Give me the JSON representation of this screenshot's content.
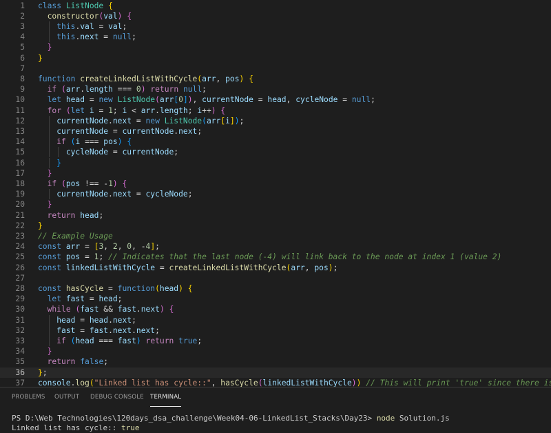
{
  "editor": {
    "active_line": 36,
    "lines": [
      [
        [
          "kw",
          "class"
        ],
        [
          "p",
          " "
        ],
        [
          "cls",
          "ListNode"
        ],
        [
          "p",
          " "
        ],
        [
          "b1",
          "{"
        ]
      ],
      [
        [
          "p",
          "  "
        ],
        [
          "fn",
          "constructor"
        ],
        [
          "b2",
          "("
        ],
        [
          "var",
          "val"
        ],
        [
          "b2",
          ")"
        ],
        [
          "p",
          " "
        ],
        [
          "b2",
          "{"
        ]
      ],
      [
        [
          "p",
          "    "
        ],
        [
          "kw",
          "this"
        ],
        [
          "p",
          "."
        ],
        [
          "var",
          "val"
        ],
        [
          "p",
          " = "
        ],
        [
          "var",
          "val"
        ],
        [
          "p",
          ";"
        ]
      ],
      [
        [
          "p",
          "    "
        ],
        [
          "kw",
          "this"
        ],
        [
          "p",
          "."
        ],
        [
          "var",
          "next"
        ],
        [
          "p",
          " = "
        ],
        [
          "kw",
          "null"
        ],
        [
          "p",
          ";"
        ]
      ],
      [
        [
          "p",
          "  "
        ],
        [
          "b2",
          "}"
        ]
      ],
      [
        [
          "b1",
          "}"
        ]
      ],
      [],
      [
        [
          "kw",
          "function"
        ],
        [
          "p",
          " "
        ],
        [
          "fn",
          "createLinkedListWithCycle"
        ],
        [
          "b1",
          "("
        ],
        [
          "var",
          "arr"
        ],
        [
          "p",
          ", "
        ],
        [
          "var",
          "pos"
        ],
        [
          "b1",
          ")"
        ],
        [
          "p",
          " "
        ],
        [
          "b1",
          "{"
        ]
      ],
      [
        [
          "p",
          "  "
        ],
        [
          "ctl",
          "if"
        ],
        [
          "p",
          " "
        ],
        [
          "b2",
          "("
        ],
        [
          "var",
          "arr"
        ],
        [
          "p",
          "."
        ],
        [
          "var",
          "length"
        ],
        [
          "p",
          " === "
        ],
        [
          "num",
          "0"
        ],
        [
          "b2",
          ")"
        ],
        [
          "p",
          " "
        ],
        [
          "ctl",
          "return"
        ],
        [
          "p",
          " "
        ],
        [
          "kw",
          "null"
        ],
        [
          "p",
          ";"
        ]
      ],
      [
        [
          "p",
          "  "
        ],
        [
          "kw",
          "let"
        ],
        [
          "p",
          " "
        ],
        [
          "var",
          "head"
        ],
        [
          "p",
          " = "
        ],
        [
          "kw",
          "new"
        ],
        [
          "p",
          " "
        ],
        [
          "cls",
          "ListNode"
        ],
        [
          "b2",
          "("
        ],
        [
          "var",
          "arr"
        ],
        [
          "b3",
          "["
        ],
        [
          "num",
          "0"
        ],
        [
          "b3",
          "]"
        ],
        [
          "b2",
          ")"
        ],
        [
          "p",
          ", "
        ],
        [
          "var",
          "currentNode"
        ],
        [
          "p",
          " = "
        ],
        [
          "var",
          "head"
        ],
        [
          "p",
          ", "
        ],
        [
          "var",
          "cycleNode"
        ],
        [
          "p",
          " = "
        ],
        [
          "kw",
          "null"
        ],
        [
          "p",
          ";"
        ]
      ],
      [
        [
          "p",
          "  "
        ],
        [
          "ctl",
          "for"
        ],
        [
          "p",
          " "
        ],
        [
          "b2",
          "("
        ],
        [
          "kw",
          "let"
        ],
        [
          "p",
          " "
        ],
        [
          "var",
          "i"
        ],
        [
          "p",
          " = "
        ],
        [
          "num",
          "1"
        ],
        [
          "p",
          "; "
        ],
        [
          "var",
          "i"
        ],
        [
          "p",
          " < "
        ],
        [
          "var",
          "arr"
        ],
        [
          "p",
          "."
        ],
        [
          "var",
          "length"
        ],
        [
          "p",
          "; "
        ],
        [
          "var",
          "i"
        ],
        [
          "p",
          "++"
        ],
        [
          "b2",
          ")"
        ],
        [
          "p",
          " "
        ],
        [
          "b2",
          "{"
        ]
      ],
      [
        [
          "p",
          "    "
        ],
        [
          "var",
          "currentNode"
        ],
        [
          "p",
          "."
        ],
        [
          "var",
          "next"
        ],
        [
          "p",
          " = "
        ],
        [
          "kw",
          "new"
        ],
        [
          "p",
          " "
        ],
        [
          "cls",
          "ListNode"
        ],
        [
          "b3",
          "("
        ],
        [
          "var",
          "arr"
        ],
        [
          "b1",
          "["
        ],
        [
          "var",
          "i"
        ],
        [
          "b1",
          "]"
        ],
        [
          "b3",
          ")"
        ],
        [
          "p",
          ";"
        ]
      ],
      [
        [
          "p",
          "    "
        ],
        [
          "var",
          "currentNode"
        ],
        [
          "p",
          " = "
        ],
        [
          "var",
          "currentNode"
        ],
        [
          "p",
          "."
        ],
        [
          "var",
          "next"
        ],
        [
          "p",
          ";"
        ]
      ],
      [
        [
          "p",
          "    "
        ],
        [
          "ctl",
          "if"
        ],
        [
          "p",
          " "
        ],
        [
          "b3",
          "("
        ],
        [
          "var",
          "i"
        ],
        [
          "p",
          " === "
        ],
        [
          "var",
          "pos"
        ],
        [
          "b3",
          ")"
        ],
        [
          "p",
          " "
        ],
        [
          "b3",
          "{"
        ]
      ],
      [
        [
          "p",
          "      "
        ],
        [
          "var",
          "cycleNode"
        ],
        [
          "p",
          " = "
        ],
        [
          "var",
          "currentNode"
        ],
        [
          "p",
          ";"
        ]
      ],
      [
        [
          "p",
          "    "
        ],
        [
          "b3",
          "}"
        ]
      ],
      [
        [
          "p",
          "  "
        ],
        [
          "b2",
          "}"
        ]
      ],
      [
        [
          "p",
          "  "
        ],
        [
          "ctl",
          "if"
        ],
        [
          "p",
          " "
        ],
        [
          "b2",
          "("
        ],
        [
          "var",
          "pos"
        ],
        [
          "p",
          " !== -"
        ],
        [
          "num",
          "1"
        ],
        [
          "b2",
          ")"
        ],
        [
          "p",
          " "
        ],
        [
          "b2",
          "{"
        ]
      ],
      [
        [
          "p",
          "    "
        ],
        [
          "var",
          "currentNode"
        ],
        [
          "p",
          "."
        ],
        [
          "var",
          "next"
        ],
        [
          "p",
          " = "
        ],
        [
          "var",
          "cycleNode"
        ],
        [
          "p",
          ";"
        ]
      ],
      [
        [
          "p",
          "  "
        ],
        [
          "b2",
          "}"
        ]
      ],
      [
        [
          "p",
          "  "
        ],
        [
          "ctl",
          "return"
        ],
        [
          "p",
          " "
        ],
        [
          "var",
          "head"
        ],
        [
          "p",
          ";"
        ]
      ],
      [
        [
          "b1",
          "}"
        ]
      ],
      [
        [
          "com",
          "// Example Usage"
        ]
      ],
      [
        [
          "kw",
          "const"
        ],
        [
          "p",
          " "
        ],
        [
          "var",
          "arr"
        ],
        [
          "p",
          " = "
        ],
        [
          "b1",
          "["
        ],
        [
          "num",
          "3"
        ],
        [
          "p",
          ", "
        ],
        [
          "num",
          "2"
        ],
        [
          "p",
          ", "
        ],
        [
          "num",
          "0"
        ],
        [
          "p",
          ", -"
        ],
        [
          "num",
          "4"
        ],
        [
          "b1",
          "]"
        ],
        [
          "p",
          ";"
        ]
      ],
      [
        [
          "kw",
          "const"
        ],
        [
          "p",
          " "
        ],
        [
          "var",
          "pos"
        ],
        [
          "p",
          " = "
        ],
        [
          "num",
          "1"
        ],
        [
          "p",
          "; "
        ],
        [
          "com",
          "// Indicates that the last node (-4) will link back to the node at index 1 (value 2)"
        ]
      ],
      [
        [
          "kw",
          "const"
        ],
        [
          "p",
          " "
        ],
        [
          "var",
          "linkedListWithCycle"
        ],
        [
          "p",
          " = "
        ],
        [
          "fn",
          "createLinkedListWithCycle"
        ],
        [
          "b1",
          "("
        ],
        [
          "var",
          "arr"
        ],
        [
          "p",
          ", "
        ],
        [
          "var",
          "pos"
        ],
        [
          "b1",
          ")"
        ],
        [
          "p",
          ";"
        ]
      ],
      [],
      [
        [
          "kw",
          "const"
        ],
        [
          "p",
          " "
        ],
        [
          "fn",
          "hasCycle"
        ],
        [
          "p",
          " = "
        ],
        [
          "kw",
          "function"
        ],
        [
          "b1",
          "("
        ],
        [
          "var",
          "head"
        ],
        [
          "b1",
          ")"
        ],
        [
          "p",
          " "
        ],
        [
          "b1",
          "{"
        ]
      ],
      [
        [
          "p",
          "  "
        ],
        [
          "kw",
          "let"
        ],
        [
          "p",
          " "
        ],
        [
          "var",
          "fast"
        ],
        [
          "p",
          " = "
        ],
        [
          "var",
          "head"
        ],
        [
          "p",
          ";"
        ]
      ],
      [
        [
          "p",
          "  "
        ],
        [
          "ctl",
          "while"
        ],
        [
          "p",
          " "
        ],
        [
          "b2",
          "("
        ],
        [
          "var",
          "fast"
        ],
        [
          "p",
          " && "
        ],
        [
          "var",
          "fast"
        ],
        [
          "p",
          "."
        ],
        [
          "var",
          "next"
        ],
        [
          "b2",
          ")"
        ],
        [
          "p",
          " "
        ],
        [
          "b2",
          "{"
        ]
      ],
      [
        [
          "p",
          "    "
        ],
        [
          "var",
          "head"
        ],
        [
          "p",
          " = "
        ],
        [
          "var",
          "head"
        ],
        [
          "p",
          "."
        ],
        [
          "var",
          "next"
        ],
        [
          "p",
          ";"
        ]
      ],
      [
        [
          "p",
          "    "
        ],
        [
          "var",
          "fast"
        ],
        [
          "p",
          " = "
        ],
        [
          "var",
          "fast"
        ],
        [
          "p",
          "."
        ],
        [
          "var",
          "next"
        ],
        [
          "p",
          "."
        ],
        [
          "var",
          "next"
        ],
        [
          "p",
          ";"
        ]
      ],
      [
        [
          "p",
          "    "
        ],
        [
          "ctl",
          "if"
        ],
        [
          "p",
          " "
        ],
        [
          "b3",
          "("
        ],
        [
          "var",
          "head"
        ],
        [
          "p",
          " === "
        ],
        [
          "var",
          "fast"
        ],
        [
          "b3",
          ")"
        ],
        [
          "p",
          " "
        ],
        [
          "ctl",
          "return"
        ],
        [
          "p",
          " "
        ],
        [
          "kw",
          "true"
        ],
        [
          "p",
          ";"
        ]
      ],
      [
        [
          "p",
          "  "
        ],
        [
          "b2",
          "}"
        ]
      ],
      [
        [
          "p",
          "  "
        ],
        [
          "ctl",
          "return"
        ],
        [
          "p",
          " "
        ],
        [
          "kw",
          "false"
        ],
        [
          "p",
          ";"
        ]
      ],
      [
        [
          "b1",
          "}"
        ],
        [
          "p",
          ";"
        ]
      ],
      [
        [
          "var",
          "console"
        ],
        [
          "p",
          "."
        ],
        [
          "fn",
          "log"
        ],
        [
          "b1",
          "("
        ],
        [
          "str",
          "\"Linked list has cycle::\""
        ],
        [
          "p",
          ", "
        ],
        [
          "fn",
          "hasCycle"
        ],
        [
          "b2",
          "("
        ],
        [
          "var",
          "linkedListWithCycle"
        ],
        [
          "b2",
          ")"
        ],
        [
          "b1",
          ")"
        ],
        [
          "p",
          " "
        ],
        [
          "com",
          "// This will print 'true' since there is a cycle"
        ]
      ]
    ]
  },
  "panel": {
    "tabs": [
      "PROBLEMS",
      "OUTPUT",
      "DEBUG CONSOLE",
      "TERMINAL"
    ],
    "active_tab": "TERMINAL",
    "terminal": {
      "prompt": "PS D:\\Web Technologies\\120days_dsa_challenge\\Week04-06-LinkedList_Stacks\\Day23> ",
      "command": "node",
      "args": " Solution.js",
      "output_label": "Linked list has cycle:: ",
      "output_value": "true"
    }
  }
}
